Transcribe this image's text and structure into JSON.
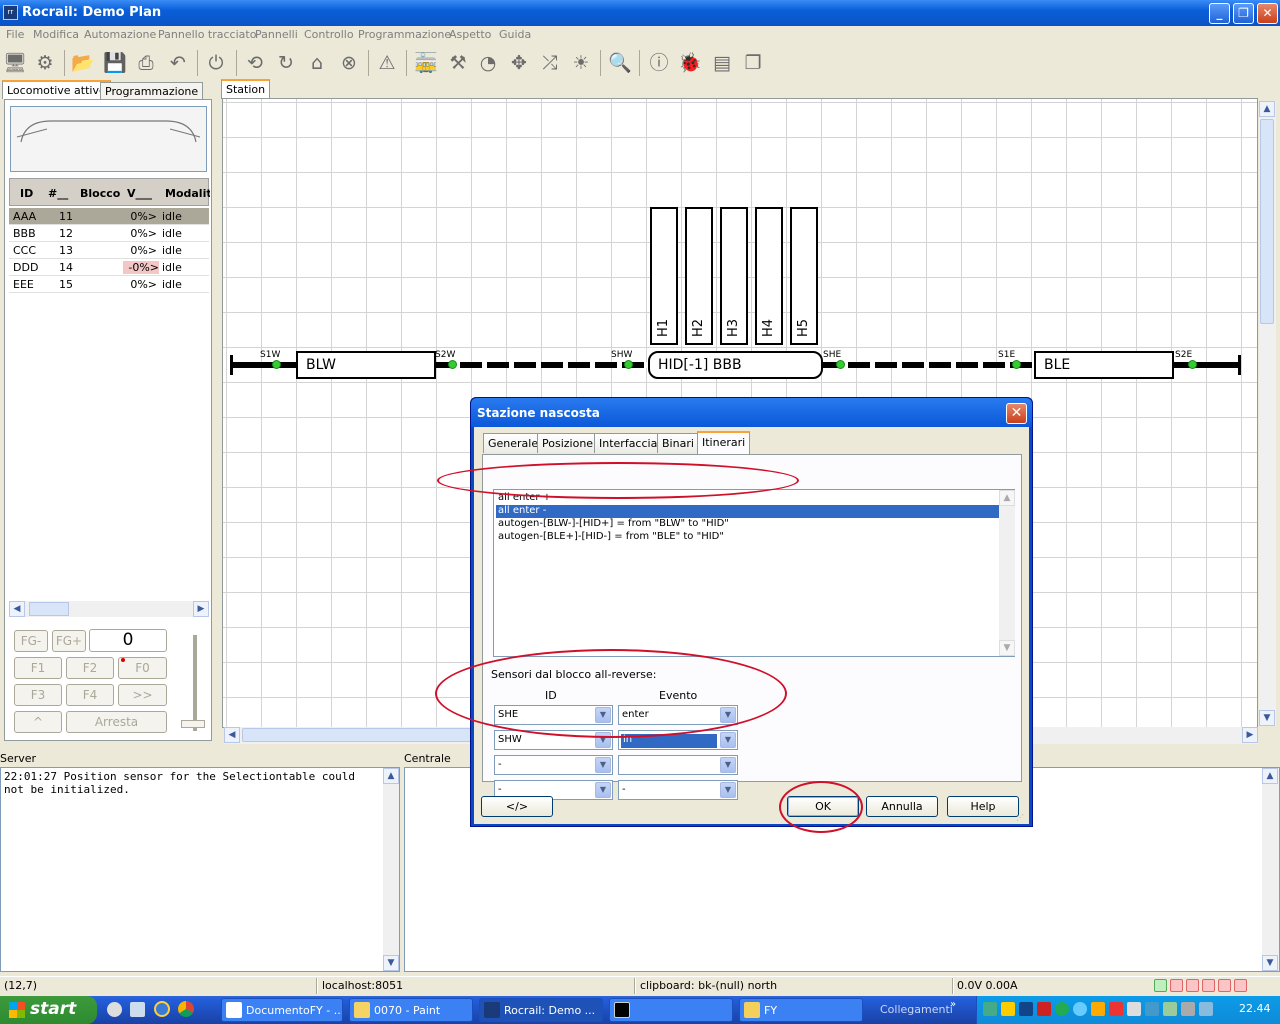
{
  "window": {
    "title": "Rocrail: Demo Plan",
    "app_icon_text": "rr"
  },
  "menu": [
    "File",
    "Modifica",
    "Automazione",
    "Pannello tracciato",
    "Pannelli",
    "Controllo",
    "Programmazione",
    "Aspetto",
    "Guida"
  ],
  "left_tabs": [
    "Locomotive attive",
    "Programmazione"
  ],
  "loco_table": {
    "headers": [
      "ID",
      "#__",
      "Blocco",
      "V___",
      "Modalità"
    ],
    "rows": [
      {
        "id": "AAA",
        "num": "11",
        "block": "",
        "v": "0%>",
        "mode": "idle"
      },
      {
        "id": "BBB",
        "num": "12",
        "block": "",
        "v": "0%>",
        "mode": "idle"
      },
      {
        "id": "CCC",
        "num": "13",
        "block": "",
        "v": "0%>",
        "mode": "idle"
      },
      {
        "id": "DDD",
        "num": "14",
        "block": "",
        "v": "-0%>",
        "mode": "idle"
      },
      {
        "id": "EEE",
        "num": "15",
        "block": "",
        "v": "0%>",
        "mode": "idle"
      }
    ]
  },
  "throttle": {
    "fg_minus": "FG-",
    "fg_plus": "FG+",
    "speed": "0",
    "f1": "F1",
    "f2": "F2",
    "f0": "F0",
    "f3": "F3",
    "f4": "F4",
    "fwd": ">>",
    "up": "^",
    "stop": "Arresta"
  },
  "plan_tab": "Station",
  "plan": {
    "sensors": [
      "S1W",
      "S2W",
      "SHW",
      "SHE",
      "S1E",
      "S2E"
    ],
    "blocks": [
      "BLW",
      "HID[-1] BBB",
      "BLE"
    ],
    "hidden_tracks": [
      "H1",
      "H2",
      "H3",
      "H4",
      "H5"
    ]
  },
  "server_label": "Server",
  "centrale_label": "Centrale",
  "server_log": "22:01:27 Position sensor for the Selectiontable could not be initialized.",
  "status": {
    "coords": "(12,7)",
    "host": "localhost:8051",
    "clipboard": "clipboard: bk-(null) north",
    "power": "0.0V 0.00A"
  },
  "dialog": {
    "title": "Stazione nascosta",
    "tabs": [
      "Generale",
      "Posizione",
      "Interfaccia",
      "Binari",
      "Itinerari"
    ],
    "routes": [
      "all enter +",
      "all enter -",
      "autogen-[BLW-]-[HID+] = from \"BLW\" to \"HID\"",
      "autogen-[BLE+]-[HID-] = from \"BLE\" to \"HID\""
    ],
    "sensors_label": "Sensori dal blocco all-reverse:",
    "col_id": "ID",
    "col_event": "Evento",
    "sensor_rows": [
      {
        "id": "SHE",
        "event": "enter"
      },
      {
        "id": "SHW",
        "event": "in"
      },
      {
        "id": "-",
        "event": ""
      },
      {
        "id": "-",
        "event": "-"
      }
    ],
    "xml_btn": "</>",
    "ok": "OK",
    "cancel": "Annulla",
    "help": "Help"
  },
  "taskbar": {
    "start": "start",
    "tasks": [
      "DocumentoFY - ...",
      "0070 - Paint",
      "Rocrail: Demo ...",
      "",
      "FY"
    ],
    "links": "Collegamenti",
    "clock": "22.44"
  },
  "colors": {
    "accent": "#316ac5",
    "annotation": "#d0102a",
    "sensor": "#33cc33"
  }
}
